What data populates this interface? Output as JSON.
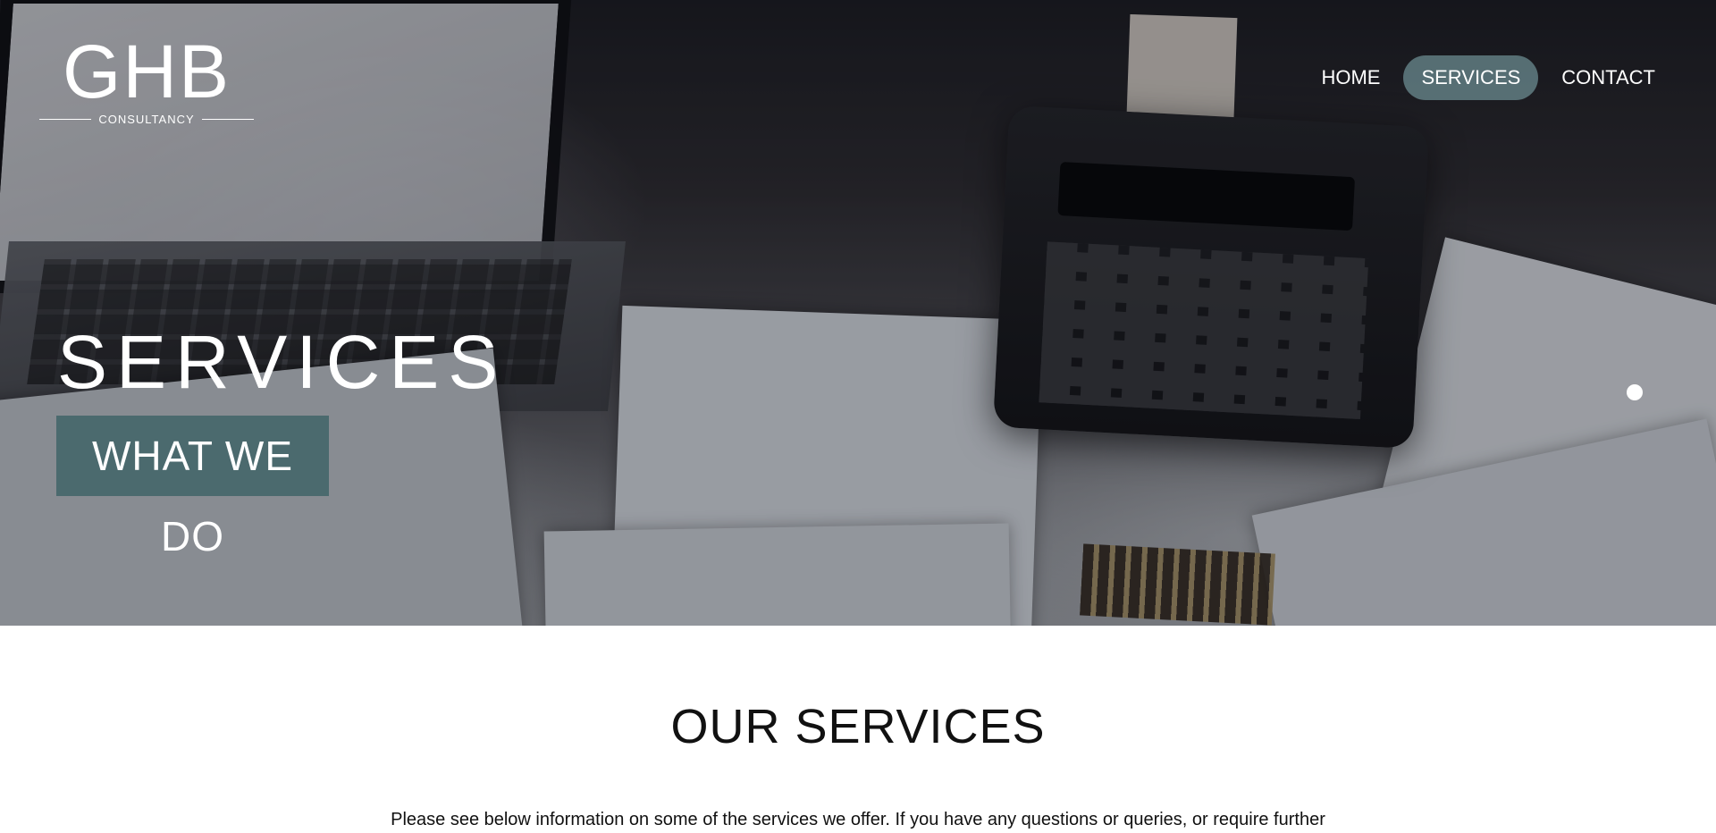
{
  "brand": {
    "logo_text": "GHB",
    "logo_subtitle": "CONSULTANCY"
  },
  "nav": {
    "items": [
      {
        "label": "HOME",
        "active": false
      },
      {
        "label": "SERVICES",
        "active": true
      },
      {
        "label": "CONTACT",
        "active": false
      }
    ]
  },
  "hero": {
    "title": "SERVICES",
    "badge": "WHAT WE DO",
    "colors": {
      "badge_bg": "#4b6a6e",
      "nav_active_bg": "#68878c"
    }
  },
  "content": {
    "heading": "OUR SERVICES",
    "intro": "Please see below information on some of the services we offer. If you have any questions or queries, or require further"
  }
}
